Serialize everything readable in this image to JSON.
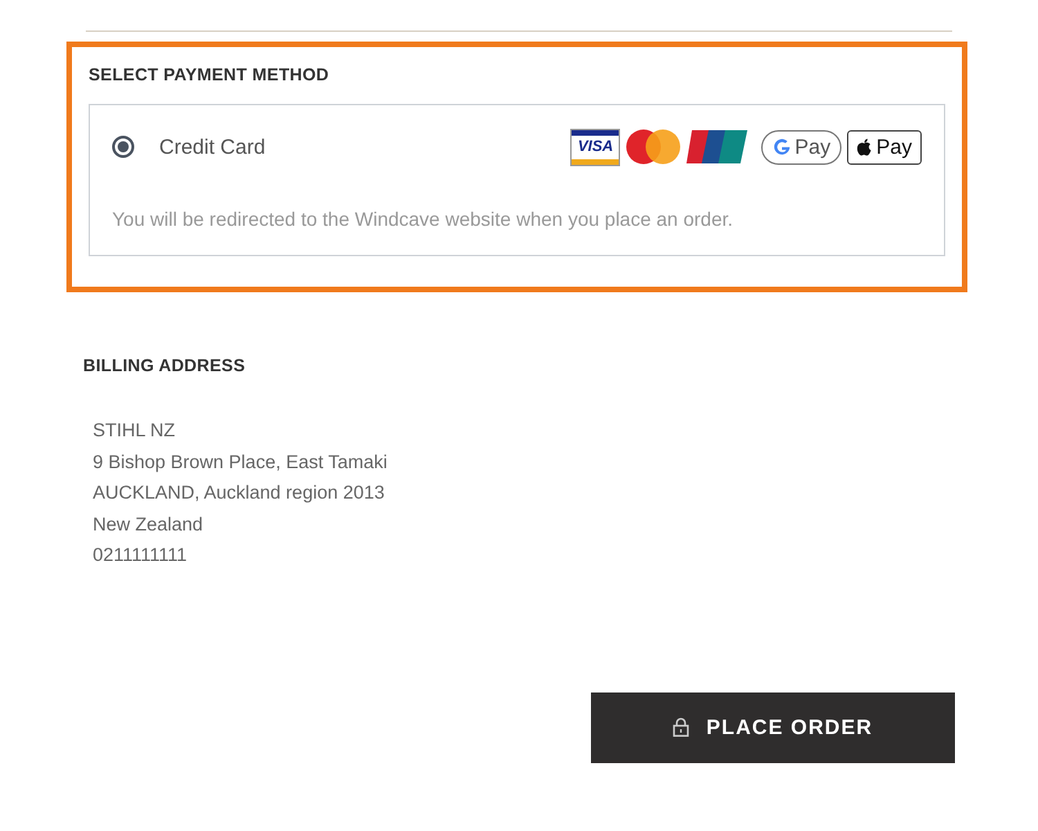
{
  "payment": {
    "title": "SELECT PAYMENT METHOD",
    "options": [
      {
        "label": "Credit Card",
        "selected": true,
        "note": "You will be redirected to the Windcave website when you place an order.",
        "logos": [
          {
            "kind": "visa",
            "label": "VISA"
          },
          {
            "kind": "mastercard"
          },
          {
            "kind": "unionpay"
          },
          {
            "kind": "gpay",
            "label": "Pay"
          },
          {
            "kind": "applepay",
            "label": "Pay"
          }
        ]
      }
    ]
  },
  "billing": {
    "title": "BILLING ADDRESS",
    "lines": [
      "STIHL NZ",
      "9 Bishop Brown Place, East Tamaki",
      "AUCKLAND, Auckland region 2013",
      "New Zealand",
      "0211111111"
    ]
  },
  "button": {
    "label": "PLACE ORDER"
  }
}
